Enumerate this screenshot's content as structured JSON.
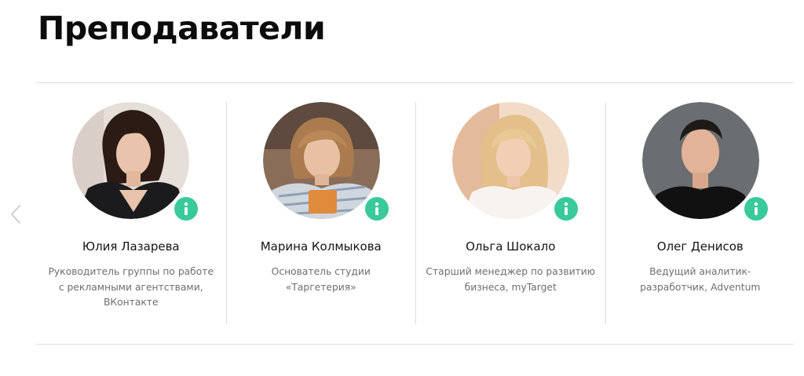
{
  "section": {
    "title": "Преподаватели"
  },
  "icons": {
    "prev": "chevron-left-icon",
    "info": "info-icon"
  },
  "colors": {
    "accent": "#3ac99a",
    "divider": "#dedede",
    "muted_text": "#6e6e6e"
  },
  "teachers": [
    {
      "name": "Юлия Лазарева",
      "role_lines": [
        "Руководитель группы по работе",
        "с рекламными агентствами,",
        "ВКонтакте"
      ]
    },
    {
      "name": "Марина Колмыкова",
      "role_lines": [
        "Основатель студии",
        "«Таргетерия»"
      ]
    },
    {
      "name": "Ольга Шокало",
      "role_lines": [
        "Старший менеджер по развитию",
        "бизнеса, myTarget"
      ]
    },
    {
      "name": "Олег Денисов",
      "role_lines": [
        "Ведущий аналитик-",
        "разработчик, Adventum"
      ]
    }
  ]
}
